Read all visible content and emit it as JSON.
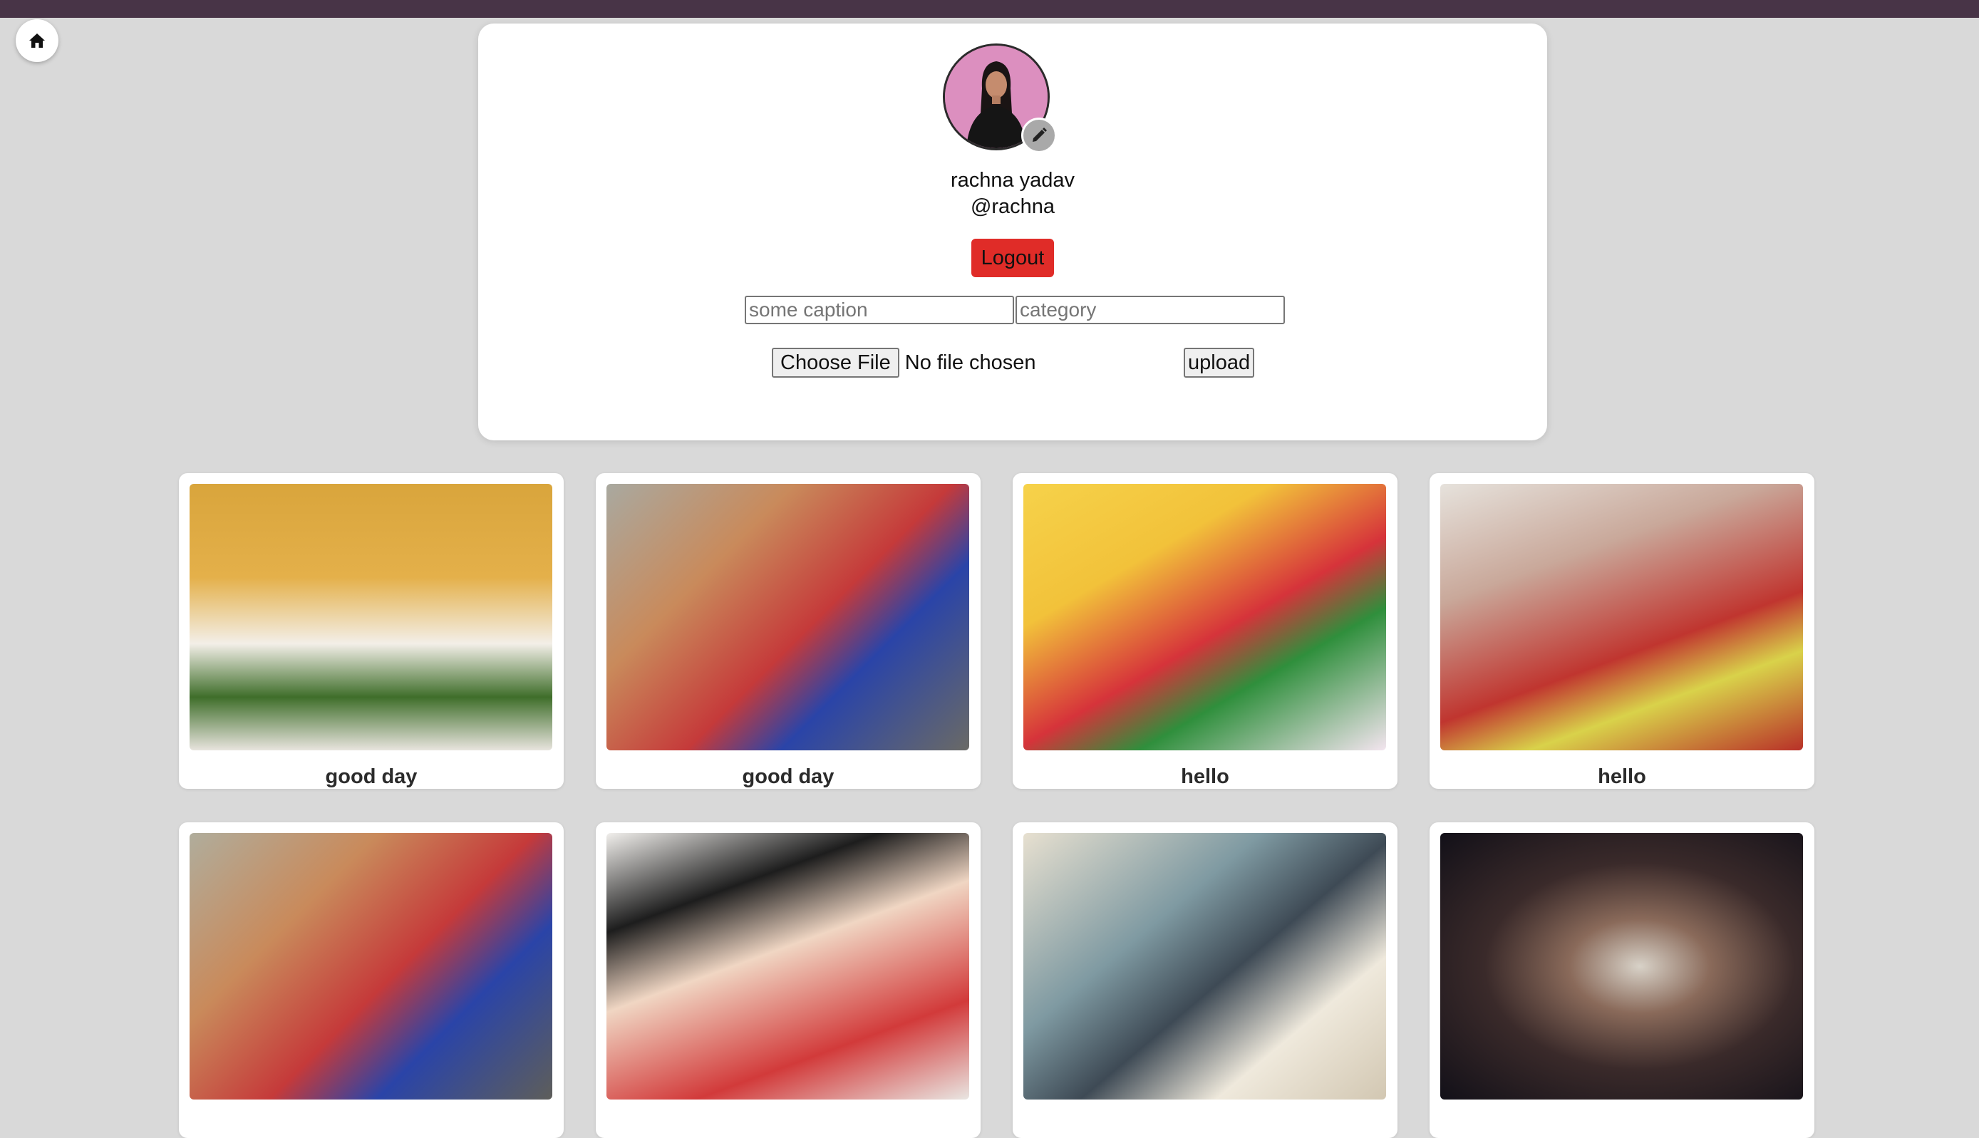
{
  "header": {
    "home_icon": "home-icon"
  },
  "profile": {
    "name": "rachna yadav",
    "handle": "@rachna",
    "logout_label": "Logout",
    "edit_icon": "pencil-icon"
  },
  "upload_form": {
    "caption_placeholder": "some caption",
    "caption_value": "",
    "category_placeholder": "category",
    "category_value": "",
    "choose_file_label": "Choose File",
    "file_status": "No file chosen",
    "upload_label": "upload"
  },
  "posts": [
    {
      "caption": "good day"
    },
    {
      "caption": "good day"
    },
    {
      "caption": "hello"
    },
    {
      "caption": "hello"
    },
    {
      "caption": ""
    },
    {
      "caption": ""
    },
    {
      "caption": ""
    },
    {
      "caption": ""
    }
  ],
  "colors": {
    "topbar": "#483447",
    "background": "#d9d9d9",
    "logout": "#e02c28"
  }
}
